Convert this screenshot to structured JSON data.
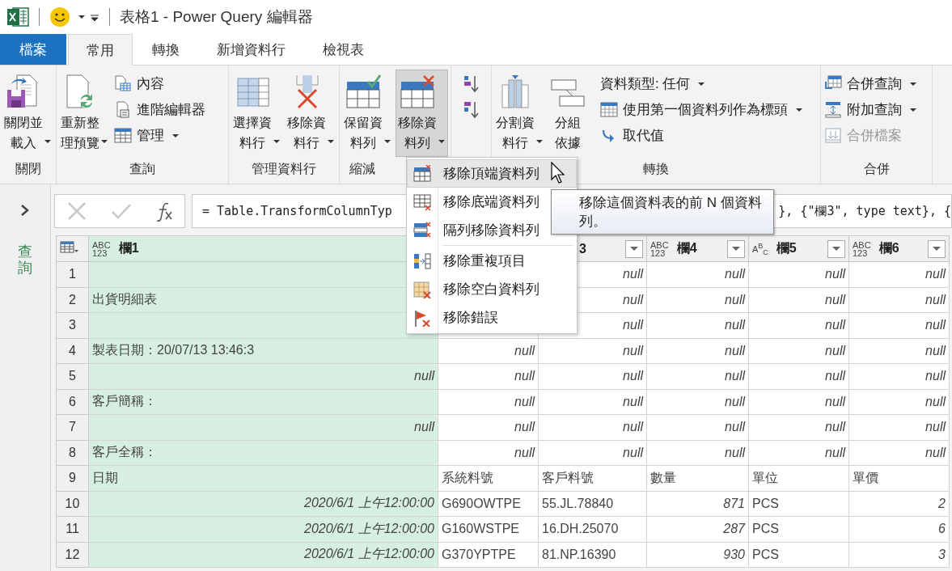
{
  "window": {
    "title": "表格1 - Power Query 編輯器"
  },
  "tabs": [
    {
      "label": "檔案",
      "kind": "file",
      "selected": false
    },
    {
      "label": "常用",
      "kind": "tab",
      "selected": true
    },
    {
      "label": "轉換",
      "kind": "tab",
      "selected": false
    },
    {
      "label": "新增資料行",
      "kind": "tab",
      "selected": false
    },
    {
      "label": "檢視表",
      "kind": "tab",
      "selected": false
    }
  ],
  "ribbon": {
    "groups": [
      {
        "label": "關閉",
        "items": [
          {
            "kind": "large",
            "label": "關閉並載入",
            "dropdown": true,
            "pressed": false
          }
        ]
      },
      {
        "label": "查詢",
        "items": [
          {
            "kind": "large",
            "label": "重新整理預覽",
            "dropdown": true,
            "pressed": false
          },
          {
            "kind": "stack",
            "items": [
              {
                "label": "內容",
                "dropdown": false,
                "disabled": false
              },
              {
                "label": "進階編輯器",
                "dropdown": false,
                "disabled": false
              },
              {
                "label": "管理",
                "dropdown": true,
                "disabled": false
              }
            ]
          }
        ]
      },
      {
        "label": "管理資料行",
        "items": [
          {
            "kind": "large",
            "label": "選擇資料行",
            "dropdown": true,
            "pressed": false
          },
          {
            "kind": "large",
            "label": "移除資料行",
            "dropdown": true,
            "pressed": false
          }
        ]
      },
      {
        "label": "縮減",
        "items": [
          {
            "kind": "large",
            "label": "保留資料列",
            "dropdown": true,
            "pressed": false
          },
          {
            "kind": "large",
            "label": "移除資料列",
            "dropdown": true,
            "pressed": true
          }
        ]
      },
      {
        "items": [
          {
            "kind": "sort"
          }
        ]
      },
      {
        "label": "轉換",
        "items": [
          {
            "kind": "large",
            "label": "分割資料行",
            "dropdown": true,
            "pressed": false
          },
          {
            "kind": "large",
            "label": "分組依據",
            "dropdown": false,
            "pressed": false
          },
          {
            "kind": "stack",
            "items": [
              {
                "label": "資料類型: 任何",
                "dropdown": true,
                "disabled": false
              },
              {
                "label": "使用第一個資料列作為標頭",
                "dropdown": true,
                "disabled": false
              },
              {
                "label": "取代值",
                "dropdown": false,
                "disabled": false
              }
            ]
          }
        ]
      },
      {
        "label": "合併",
        "items": [
          {
            "kind": "stack",
            "items": [
              {
                "label": "合併查詢",
                "dropdown": true,
                "disabled": false
              },
              {
                "label": "附加查詢",
                "dropdown": true,
                "disabled": false
              },
              {
                "label": "合併檔案",
                "dropdown": false,
                "disabled": true
              }
            ]
          }
        ]
      }
    ]
  },
  "queries_pane": {
    "label": "查詢",
    "expanded": false
  },
  "formula_bar": {
    "parts": [
      "= Table.TransformColumnTyp",
      "}, {\"欄3\", type text}, {"
    ]
  },
  "table": {
    "columns": [
      {
        "label": "欄1",
        "type_icon": [
          "ABC",
          "123"
        ]
      },
      {},
      {
        "label": "3",
        "filter_button": true
      },
      {
        "label": "欄4",
        "type_icon": [
          "ABC",
          "123"
        ],
        "filter_button": true
      },
      {
        "label": "欄5",
        "type_icon": [
          "A$^{B}$$_{C}$"
        ],
        "filter_button": true
      },
      {
        "label": "欄6",
        "type_icon": [
          "ABC",
          "123"
        ],
        "filter_button": true
      }
    ],
    "rows": [
      {
        "number": "1",
        "cells": [
          "",
          "",
          {
            "text": "null",
            "italic": true
          },
          {
            "text": "null",
            "italic": true
          },
          {
            "text": "null",
            "italic": true
          },
          {
            "text": "null",
            "italic": true
          }
        ]
      },
      {
        "number": "2",
        "cells": [
          {
            "text": "出貨明細表",
            "italic": false
          },
          "",
          {
            "text": "null",
            "italic": true
          },
          {
            "text": "null",
            "italic": true
          },
          {
            "text": "null",
            "italic": true
          },
          {
            "text": "null",
            "italic": true
          }
        ]
      },
      {
        "number": "3",
        "cells": [
          "",
          "",
          {
            "text": "null",
            "italic": true
          },
          {
            "text": "null",
            "italic": true
          },
          {
            "text": "null",
            "italic": true
          },
          {
            "text": "null",
            "italic": true
          }
        ]
      },
      {
        "number": "4",
        "cells": [
          {
            "text": "製表日期：20/07/13 13:46:3",
            "italic": false
          },
          {
            "text": "null",
            "italic": true
          },
          {
            "text": "null",
            "italic": true
          },
          {
            "text": "null",
            "italic": true
          },
          {
            "text": "null",
            "italic": true
          },
          {
            "text": "null",
            "italic": true
          }
        ]
      },
      {
        "number": "5",
        "cells": [
          {
            "text": "null",
            "italic": true
          },
          {
            "text": "null",
            "italic": true
          },
          {
            "text": "null",
            "italic": true
          },
          {
            "text": "null",
            "italic": true
          },
          {
            "text": "null",
            "italic": true
          },
          {
            "text": "null",
            "italic": true
          }
        ]
      },
      {
        "number": "6",
        "cells": [
          {
            "text": "客戶簡稱：",
            "italic": false
          },
          {
            "text": "null",
            "italic": true
          },
          {
            "text": "null",
            "italic": true
          },
          {
            "text": "null",
            "italic": true
          },
          {
            "text": "null",
            "italic": true
          },
          {
            "text": "null",
            "italic": true
          }
        ]
      },
      {
        "number": "7",
        "cells": [
          {
            "text": "null",
            "italic": true
          },
          {
            "text": "null",
            "italic": true
          },
          {
            "text": "null",
            "italic": true
          },
          {
            "text": "null",
            "italic": true
          },
          {
            "text": "null",
            "italic": true
          },
          {
            "text": "null",
            "italic": true
          }
        ]
      },
      {
        "number": "8",
        "cells": [
          {
            "text": "客戶全稱：",
            "italic": false
          },
          {
            "text": "null",
            "italic": true
          },
          {
            "text": "null",
            "italic": true
          },
          {
            "text": "null",
            "italic": true
          },
          {
            "text": "null",
            "italic": true
          },
          {
            "text": "null",
            "italic": true
          }
        ]
      },
      {
        "number": "9",
        "cells": [
          {
            "text": "日期",
            "italic": false
          },
          {
            "text": "系統料號",
            "italic": false
          },
          {
            "text": "客戶料號",
            "italic": false
          },
          {
            "text": "數量",
            "italic": false
          },
          {
            "text": "單位",
            "italic": false
          },
          {
            "text": "單價",
            "italic": false
          }
        ]
      },
      {
        "number": "10",
        "cells": [
          {
            "text": "2020/6/1 上午12:00:00",
            "italic": true
          },
          {
            "text": "G690OWTPE",
            "italic": false
          },
          {
            "text": "55.JL.78840",
            "italic": false
          },
          {
            "text": "871",
            "italic": true
          },
          {
            "text": "PCS",
            "italic": false
          },
          {
            "text": "2",
            "italic": true
          }
        ]
      },
      {
        "number": "11",
        "cells": [
          {
            "text": "2020/6/1 上午12:00:00",
            "italic": true
          },
          {
            "text": "G160WSTPE",
            "italic": false
          },
          {
            "text": "16.DH.25070",
            "italic": false
          },
          {
            "text": "287",
            "italic": true
          },
          {
            "text": "PCS",
            "italic": false
          },
          {
            "text": "6",
            "italic": true
          }
        ]
      },
      {
        "number": "12",
        "cells": [
          {
            "text": "2020/6/1 上午12:00:00",
            "italic": true
          },
          {
            "text": "G370YPTPE",
            "italic": false
          },
          {
            "text": "81.NP.16390",
            "italic": false
          },
          {
            "text": "930",
            "italic": true
          },
          {
            "text": "PCS",
            "italic": false
          },
          {
            "text": "3",
            "italic": true
          }
        ]
      }
    ]
  },
  "dropdown_menu": {
    "items": [
      {
        "label": "移除頂端資料列",
        "selected": true,
        "divider_before": false
      },
      {
        "label": "移除底端資料列",
        "selected": false,
        "divider_before": false
      },
      {
        "label": "隔列移除資料列",
        "selected": false,
        "divider_before": false
      },
      {
        "label": "移除重複項目",
        "selected": false,
        "divider_before": true
      },
      {
        "label": "移除空白資料列",
        "selected": false,
        "divider_before": false
      },
      {
        "label": "移除錯誤",
        "selected": false,
        "divider_before": false
      }
    ]
  },
  "tooltip": {
    "text": "移除這個資料表的前 N 個資料列。"
  }
}
